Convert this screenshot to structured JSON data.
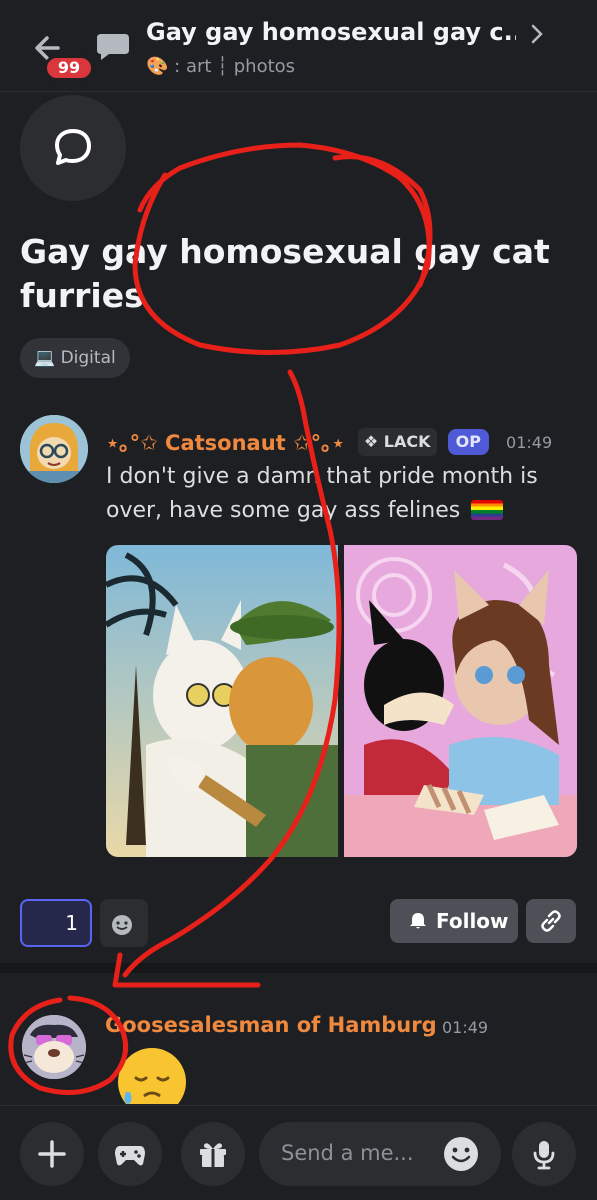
{
  "header": {
    "title": "Gay gay homosexual gay c...",
    "unread_badge": "99",
    "subtitle_prefix": ": art",
    "subtitle_sep": "┆",
    "subtitle_channel": "photos"
  },
  "thread": {
    "title": "Gay gay homosexual gay cat furries",
    "tag": "💻 Digital"
  },
  "message": {
    "author": "⋆｡°✩ Catsonaut ✩°｡⋆",
    "role_badge": "❖ LACK",
    "op_badge": "OP",
    "time": "01:49",
    "text": "I don't give a damn that pride month is over, have some gay ass felines"
  },
  "actions": {
    "reaction_count": "1",
    "follow_label": "Follow"
  },
  "reply": {
    "author": "Goosesalesman of Hamburg",
    "time": "01:49"
  },
  "composer": {
    "placeholder": "Send a me..."
  },
  "colors": {
    "background": "#1e1f22",
    "author_orange": "#f0883e",
    "blurple": "#5865f2",
    "annotation_red": "#e8201a"
  },
  "icons": [
    "back-arrow-icon",
    "thread-icon",
    "palette-icon",
    "chevron-right-icon",
    "chat-bubble-icon",
    "laptop-icon",
    "add-reaction-icon",
    "bell-icon",
    "link-icon",
    "plus-icon",
    "gamepad-icon",
    "gift-icon",
    "smile-icon",
    "mic-icon",
    "crying-face-emoji"
  ]
}
